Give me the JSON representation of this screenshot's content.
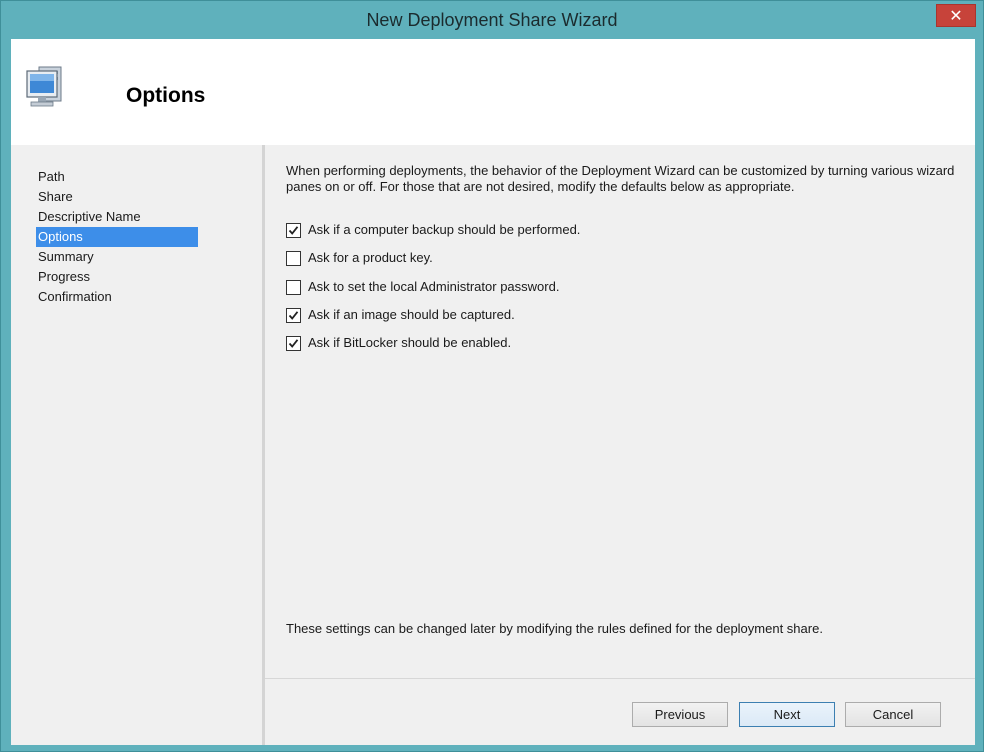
{
  "window": {
    "title": "New Deployment Share Wizard",
    "close_label": "✕"
  },
  "header": {
    "icon": "computer-icon",
    "heading": "Options"
  },
  "nav": {
    "items": [
      {
        "label": "Path"
      },
      {
        "label": "Share"
      },
      {
        "label": "Descriptive Name"
      },
      {
        "label": "Options",
        "selected": true
      },
      {
        "label": "Summary"
      },
      {
        "label": "Progress"
      },
      {
        "label": "Confirmation"
      }
    ]
  },
  "content": {
    "intro": "When performing deployments, the behavior of the Deployment Wizard can be customized by turning various wizard panes on or off.  For those that are not desired, modify the defaults below as appropriate.",
    "options": [
      {
        "label": "Ask if a computer backup should be performed.",
        "checked": true
      },
      {
        "label": "Ask for a product key.",
        "checked": false
      },
      {
        "label": "Ask to set the local Administrator password.",
        "checked": false
      },
      {
        "label": "Ask if an image should be captured.",
        "checked": true
      },
      {
        "label": "Ask if BitLocker should be enabled.",
        "checked": true
      }
    ],
    "footnote": "These settings can be changed later by modifying the rules defined for the deployment share."
  },
  "buttons": {
    "previous": "Previous",
    "next": "Next",
    "cancel": "Cancel"
  },
  "colors": {
    "window_frame": "#5fb1bc",
    "close_button": "#c7433a",
    "selection": "#3d8ee9"
  }
}
